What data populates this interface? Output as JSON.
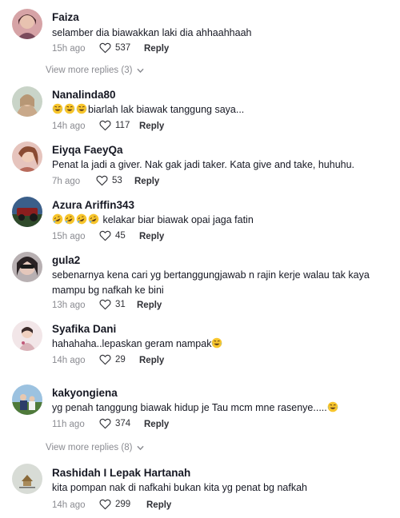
{
  "comments": [
    {
      "username": "Faiza",
      "text": "selamber dia biawakkan laki dia ahhaahhaah",
      "time": "15h ago",
      "likes": "537",
      "reply": "Reply",
      "avatar_color": "#7a4b5c"
    },
    {
      "username": "Nanalinda80",
      "text": "biarlah lak biawak tanggung saya...",
      "emoji_prefix": [
        "laughing-crying-emoji",
        "laughing-crying-emoji",
        "laughing-crying-emoji"
      ],
      "time": "14h ago",
      "likes": "117",
      "reply": "Reply",
      "avatar_color": "#c9a98a"
    },
    {
      "username": "Eiyqa FaeyQa",
      "text": "Penat la jadi a giver. Nak gak jadi taker. Kata give and take, huhuhu.",
      "time": "7h ago",
      "likes": "53",
      "reply": "Reply",
      "avatar_color": "#b86b5c"
    },
    {
      "username": "Azura Ariffin343",
      "text": "kelakar biar biawak opai jaga fatin",
      "emoji_prefix": [
        "rolling-laughing-emoji",
        "rolling-laughing-emoji",
        "rolling-laughing-emoji",
        "rolling-laughing-emoji"
      ],
      "time": "15h ago",
      "likes": "45",
      "reply": "Reply",
      "avatar_color": "#2e3b4a"
    },
    {
      "username": "gula2",
      "text": "sebenarnya kena cari yg bertanggungjawab n rajin kerje walau tak kaya mampu bg nafkah ke bini",
      "time": "13h ago",
      "likes": "31",
      "reply": "Reply",
      "avatar_color": "#6e5f63"
    },
    {
      "username": "Syafika Dani",
      "text": "hahahaha..lepaskan geram nampak",
      "emoji_suffix": [
        "laughing-crying-emoji"
      ],
      "time": "14h ago",
      "likes": "29",
      "reply": "Reply",
      "avatar_color": "#d9b2b8"
    },
    {
      "username": "kakyongiena",
      "text": "yg penah tanggung biawak hidup je Tau mcm mne rasenye.....",
      "emoji_suffix": [
        "laughing-crying-emoji"
      ],
      "time": "11h ago",
      "likes": "374",
      "reply": "Reply",
      "avatar_color": "#4d6b8a"
    },
    {
      "username": "Rashidah I Lepak Hartanah",
      "text": "kita pompan nak di nafkahi bukan kita yg penat bg nafkah",
      "time": "14h ago",
      "likes": "299",
      "reply": "Reply",
      "avatar_color": "#d8dcd6"
    }
  ],
  "view_more": [
    {
      "label": "View more replies (3)"
    },
    {
      "label": "View more replies (8)"
    }
  ],
  "colors": {
    "text": "#161823",
    "muted": "#8a8b91",
    "action": "#2f3036"
  }
}
